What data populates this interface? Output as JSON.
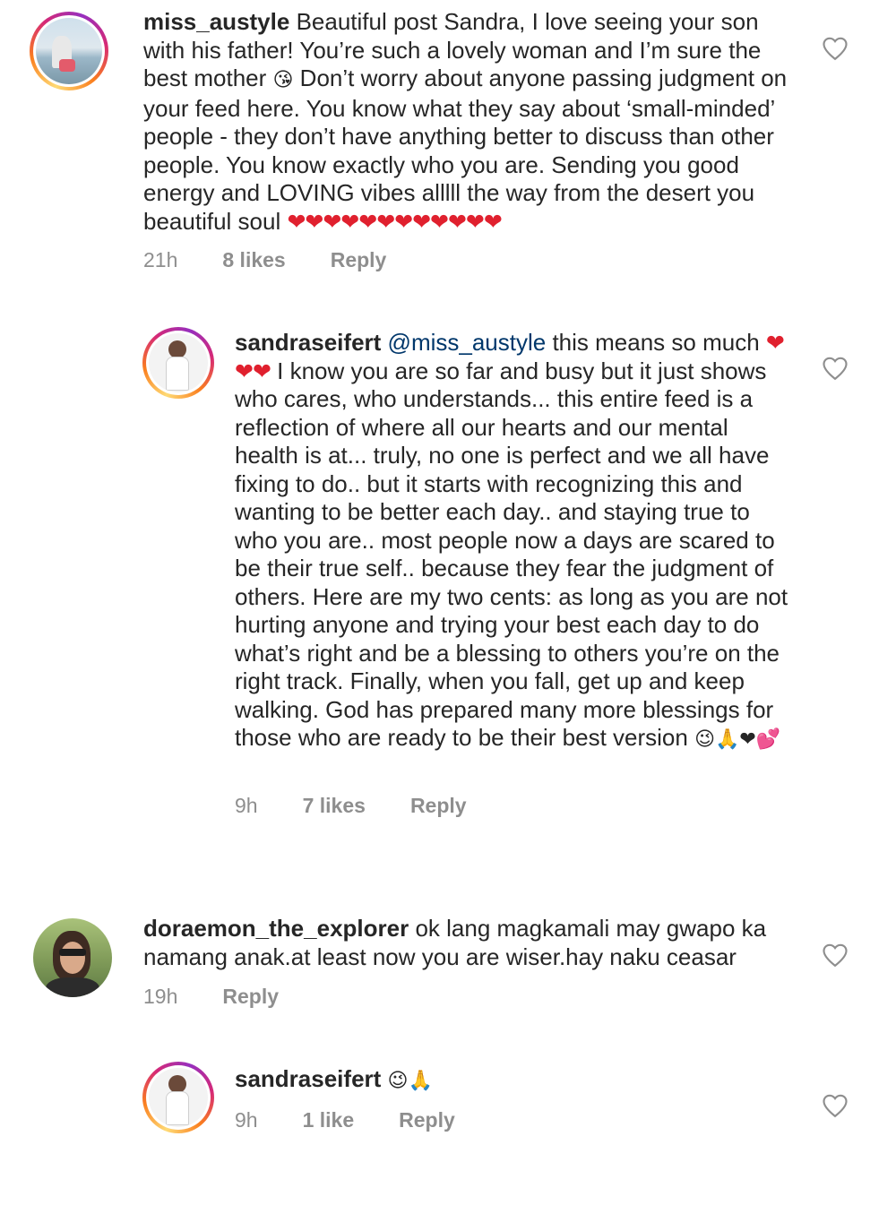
{
  "comments": [
    {
      "username": "miss_austyle",
      "text_parts": [
        "Beautiful post Sandra, I love seeing your son with his father! You’re such a lovely woman and I’m sure the best mother ",
        " Don’t worry about anyone passing judgment on your feed here. You know what they say about ‘small-minded’ people - they don’t have anything better to discuss than other people. You know exactly who you are. Sending you good energy and LOVING vibes alllll the way from the desert you beautiful soul "
      ],
      "emoji_kiss": "😘",
      "hearts": "❤❤❤❤❤❤❤❤❤❤❤❤",
      "time": "21h",
      "likes": "8 likes",
      "reply": "Reply",
      "like_icon": "heart-outline-icon"
    },
    {
      "username": "sandraseifert",
      "mention": "@miss_austyle",
      "text_parts": [
        " this means so much ",
        " I know you are so far and busy but it just shows who cares, who understands... this entire feed is a reflection of where all our hearts and our mental health is at... truly, no one is perfect and we all have fixing to do.. but it starts with recognizing this and wanting to be better each day.. and staying true to who you are.. most people now a days are scared to be their true self.. because they fear the judgment of others. Here are my two cents: as long as you are not hurting anyone and trying your best each day to do what’s right and be a blessing to others you’re on the right track. Finally, when you fall, get up and keep walking. God has prepared many more blessings for those who are ready to be their best version "
      ],
      "hearts": "❤❤❤",
      "end_emojis": "😉🙏❤💕",
      "time": "9h",
      "likes": "7 likes",
      "reply": "Reply",
      "like_icon": "heart-outline-icon"
    },
    {
      "username": "doraemon_the_explorer",
      "text": "ok lang magkamali may gwapo ka namang anak.at least now you are wiser.hay naku ceasar",
      "time": "19h",
      "reply": "Reply",
      "like_icon": "heart-outline-icon"
    },
    {
      "username": "sandraseifert",
      "emojis": "😉🙏",
      "time": "9h",
      "likes": "1 like",
      "reply": "Reply",
      "like_icon": "heart-outline-icon"
    }
  ]
}
